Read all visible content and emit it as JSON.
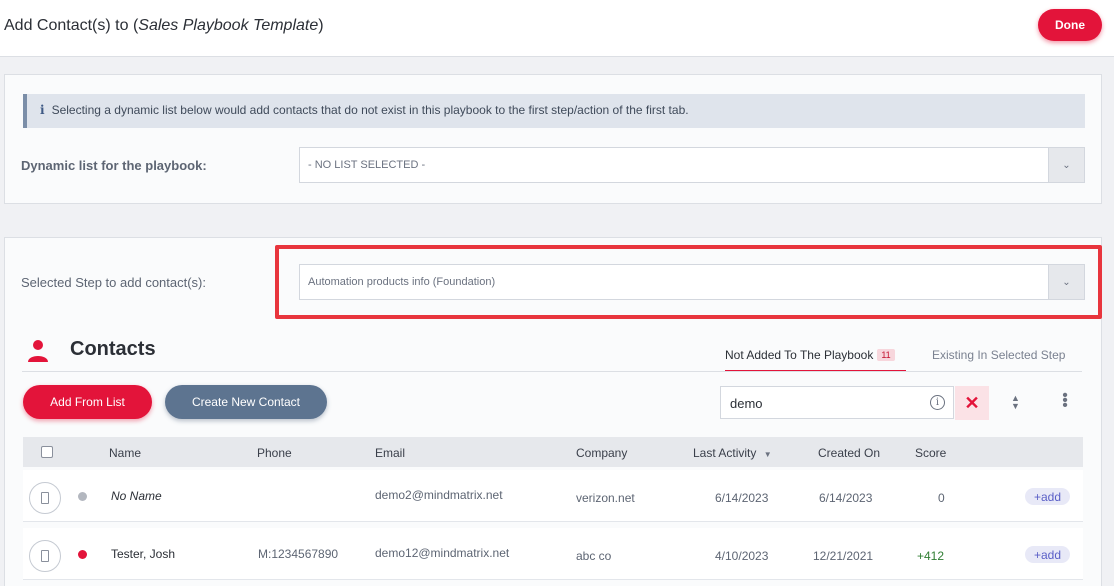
{
  "header": {
    "title_prefix": "Add Contact(s) to (",
    "playbook_name": "Sales Playbook Template",
    "title_suffix": ")",
    "done_label": "Done"
  },
  "dynamic_list": {
    "info_text": "Selecting a dynamic list below would add contacts that do not exist in this playbook to the first step/action of the first tab.",
    "label": "Dynamic list for the playbook:",
    "selected": "- NO LIST SELECTED -"
  },
  "step": {
    "label": "Selected Step to add contact(s):",
    "selected": "Automation products info (Foundation)"
  },
  "contacts": {
    "title": "Contacts",
    "tabs": [
      {
        "label": "Not Added To The Playbook",
        "badge": "11",
        "active": true
      },
      {
        "label": "Existing In Selected Step",
        "active": false
      }
    ],
    "add_from_list_label": "Add From List",
    "create_new_label": "Create New Contact",
    "search_value": "demo",
    "columns": {
      "name": "Name",
      "phone": "Phone",
      "email": "Email",
      "company": "Company",
      "last_activity": "Last Activity",
      "created_on": "Created On",
      "score": "Score"
    },
    "rows": [
      {
        "name": "No Name",
        "phone": "",
        "email": "demo2@mindmatrix.net",
        "company": "verizon.net",
        "last_activity": "6/14/2023",
        "created_on": "6/14/2023",
        "score": "0",
        "status_color": "#b3b7bf",
        "add_label": "+add"
      },
      {
        "name": "Tester, Josh",
        "phone": "M:1234567890",
        "email": "demo12@mindmatrix.net",
        "company": "abc co",
        "last_activity": "4/10/2023",
        "created_on": "12/21/2021",
        "score": "+412",
        "status_color": "#e3143a",
        "add_label": "+add"
      }
    ]
  },
  "colors": {
    "accent": "#e3143a",
    "secondary_button": "#5d7490",
    "highlight_border": "#e8353d",
    "score_positive": "#2f7d32"
  }
}
